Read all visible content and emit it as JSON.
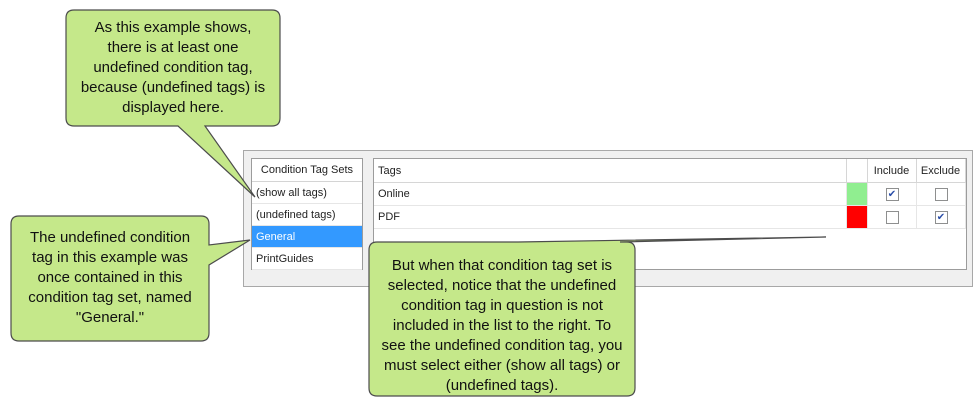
{
  "condition_tag_sets": {
    "header": "Condition Tag Sets",
    "items": [
      {
        "label": "(show all tags)",
        "selected": false
      },
      {
        "label": "(undefined tags)",
        "selected": false
      },
      {
        "label": "General",
        "selected": true
      },
      {
        "label": "PrintGuides",
        "selected": false
      }
    ]
  },
  "tags_grid": {
    "columns": {
      "tags": "Tags",
      "include": "Include",
      "exclude": "Exclude"
    },
    "rows": [
      {
        "name": "Online",
        "color": "#90ee90",
        "include": true,
        "exclude": false
      },
      {
        "name": "PDF",
        "color": "#ff0000",
        "include": false,
        "exclude": true
      }
    ]
  },
  "callouts": {
    "top": [
      "As this example shows,",
      "there is at least one",
      "undefined condition tag,",
      "because (undefined tags) is",
      "displayed here."
    ],
    "left": [
      "The undefined condition",
      "tag in this example was",
      "once contained in this",
      "condition tag set, named",
      "\"General.\""
    ],
    "bottom": [
      "But when that condition tag set is",
      "selected, notice that the undefined",
      "condition tag in question is not",
      "included in the list to the right. To",
      "see the undefined condition tag, you",
      "must select either (show all tags) or",
      "(undefined tags)."
    ]
  },
  "colors": {
    "callout_fill": "#c5e88a",
    "callout_stroke": "#4c4c4c",
    "selection": "#3399ff"
  }
}
